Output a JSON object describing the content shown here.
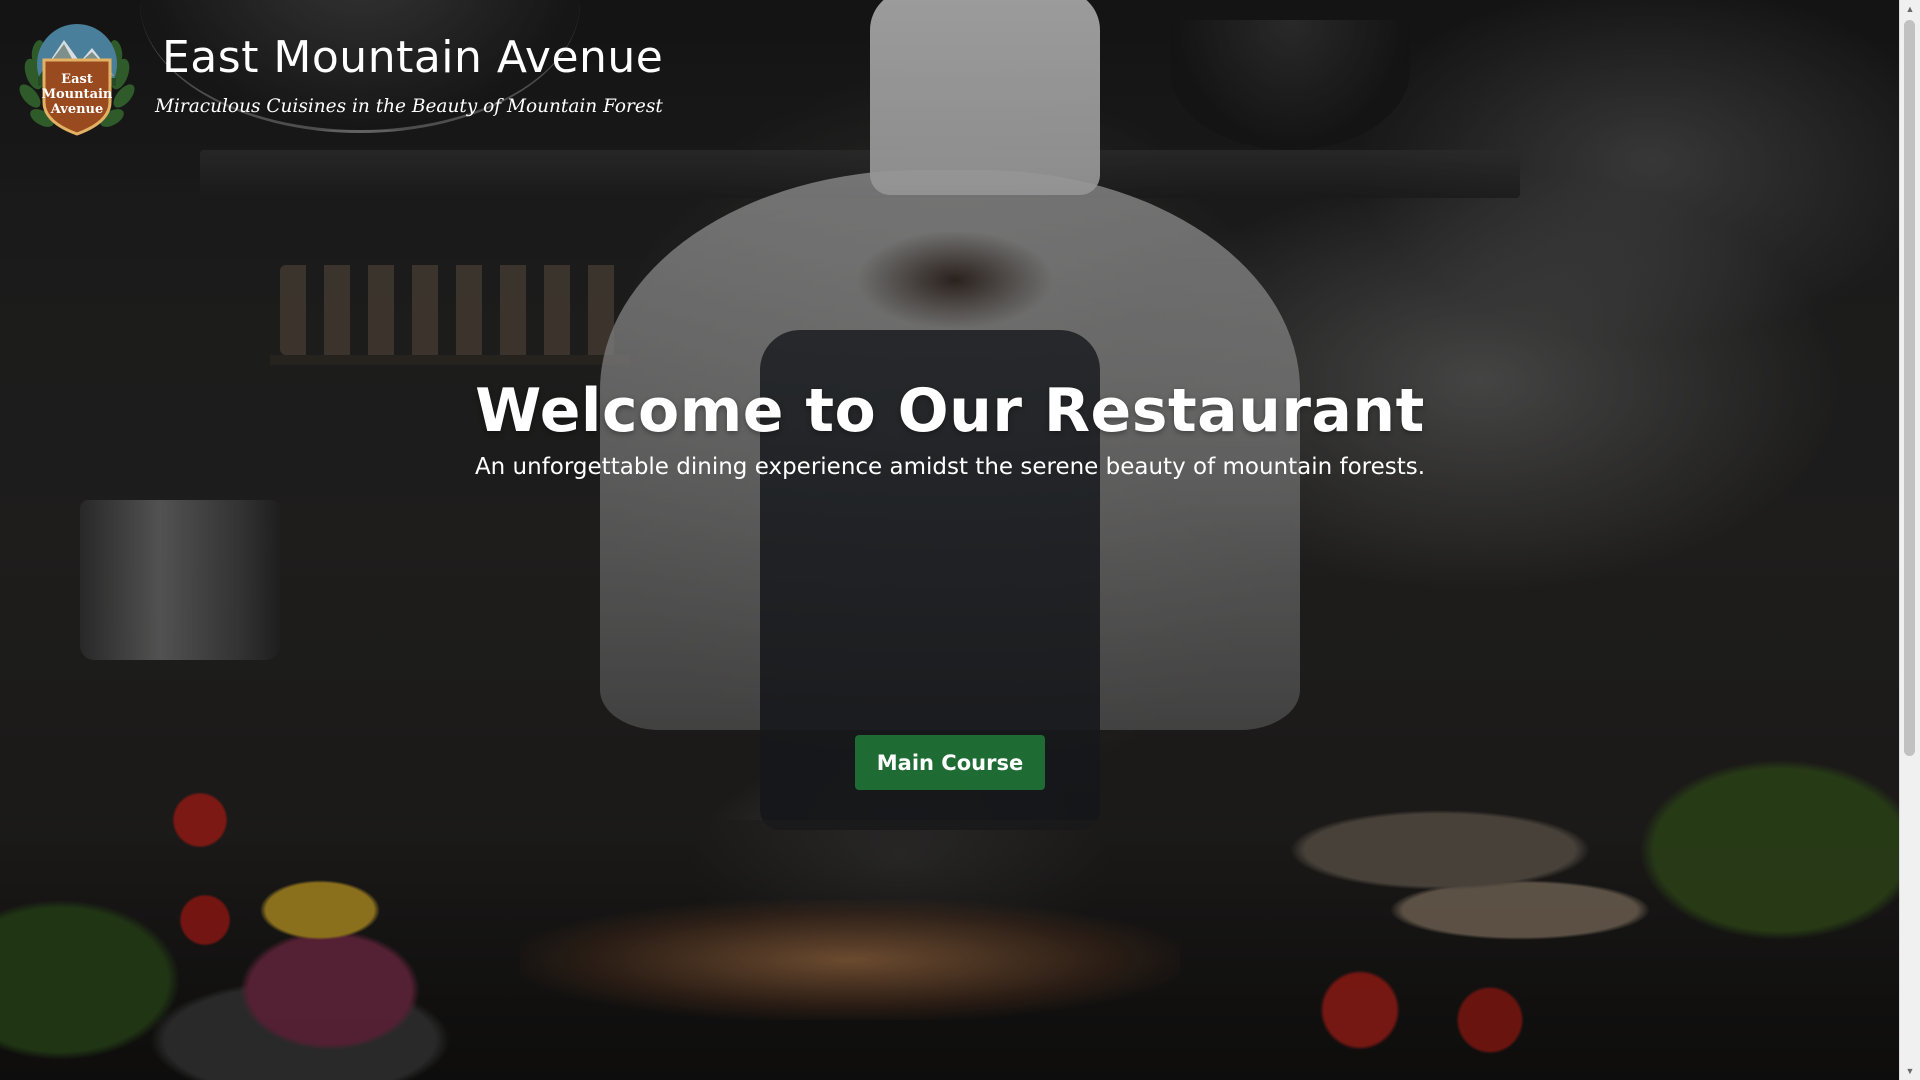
{
  "header": {
    "brand_title": "East Mountain Avenue",
    "tagline": "Miraculous Cuisines in the Beauty of Mountain Forest",
    "logo_text": [
      "East",
      "Mountain",
      "Avenue"
    ]
  },
  "hero": {
    "title": "Welcome to Our Restaurant",
    "subtitle": "An unforgettable dining experience amidst the serene beauty of mountain forests.",
    "cta_label": "Main Course"
  },
  "colors": {
    "cta_background": "#1e6b34",
    "text": "#ffffff",
    "logo_shield": "#9a4a1f",
    "logo_wreath": "#2f5a2a"
  },
  "icons": {
    "scroll_up": "triangle-up-icon",
    "scroll_down": "triangle-down-icon"
  }
}
